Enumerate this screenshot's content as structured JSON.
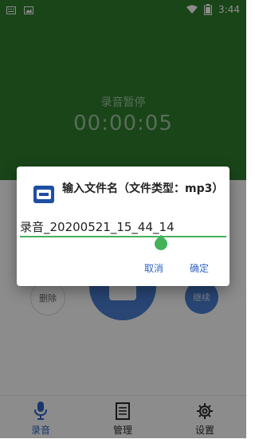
{
  "status_bar": {
    "time": "3:44",
    "icons": [
      "keyboard-icon",
      "image-icon",
      "wifi-icon",
      "battery-icon"
    ]
  },
  "recorder": {
    "status_text": "录音暂停",
    "timer": "00:00:05",
    "buttons": {
      "delete": "删除",
      "continue": "继续"
    }
  },
  "bottom_nav": {
    "items": [
      {
        "label": "录音",
        "icon": "microphone-icon",
        "active": true
      },
      {
        "label": "管理",
        "icon": "notes-icon",
        "active": false
      },
      {
        "label": "设置",
        "icon": "gear-icon",
        "active": false
      }
    ]
  },
  "dialog": {
    "title": "输入文件名（文件类型：mp3）",
    "filename_value": "录音_20200521_15_44_14",
    "cancel_label": "取消",
    "ok_label": "确定",
    "accent_color": "#44b25a",
    "button_color": "#2f64c8"
  }
}
